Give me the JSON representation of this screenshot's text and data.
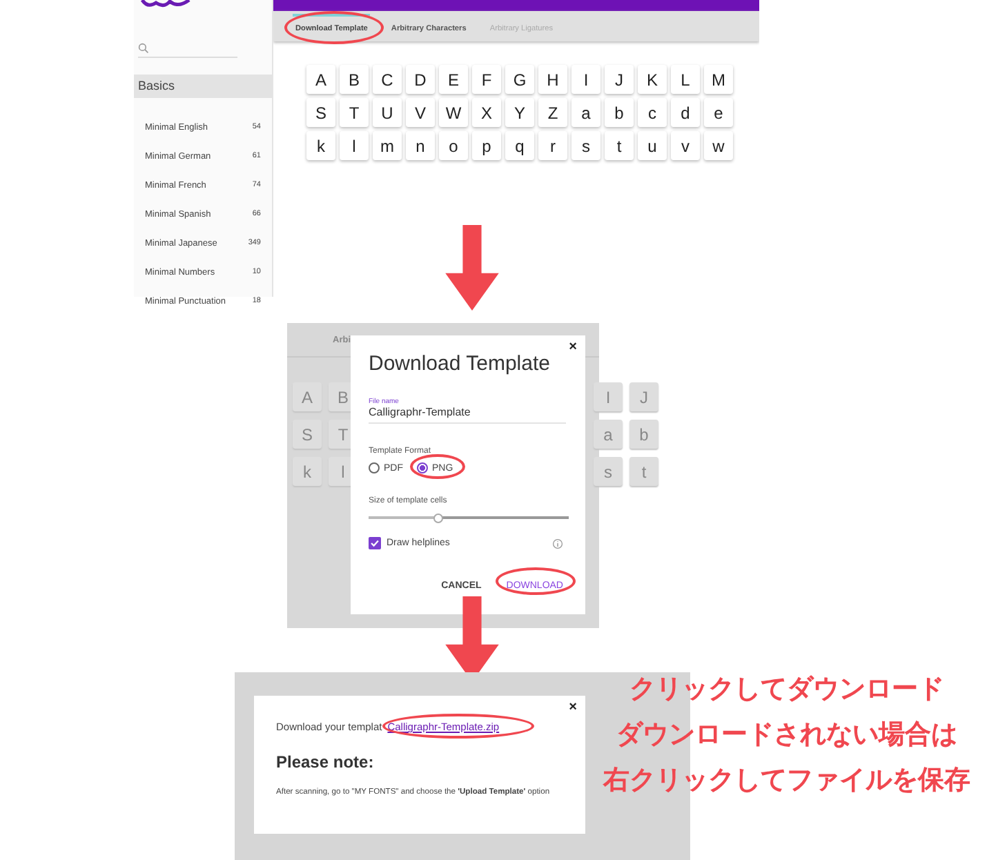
{
  "step1": {
    "sidebar": {
      "section": {
        "label": "Basics",
        "selected": true
      },
      "items": [
        {
          "label": "Minimal English",
          "count": "54"
        },
        {
          "label": "Minimal German",
          "count": "61"
        },
        {
          "label": "Minimal French",
          "count": "74"
        },
        {
          "label": "Minimal Spanish",
          "count": "66"
        },
        {
          "label": "Minimal Japanese",
          "count": "349"
        },
        {
          "label": "Minimal Numbers",
          "count": "10"
        },
        {
          "label": "Minimal Punctuation",
          "count": "18"
        }
      ]
    },
    "tabs": [
      {
        "label": "Download Template",
        "selected": true,
        "disabled": false
      },
      {
        "label": "Arbitrary Characters",
        "selected": false,
        "disabled": false
      },
      {
        "label": "Arbitrary Ligatures",
        "selected": false,
        "disabled": true
      }
    ],
    "characters": [
      [
        "A",
        "B",
        "C",
        "D",
        "E",
        "F",
        "G",
        "H",
        "I",
        "J",
        "K",
        "L",
        "M"
      ],
      [
        "S",
        "T",
        "U",
        "V",
        "W",
        "X",
        "Y",
        "Z",
        "a",
        "b",
        "c",
        "d",
        "e"
      ],
      [
        "k",
        "l",
        "m",
        "n",
        "o",
        "p",
        "q",
        "r",
        "s",
        "t",
        "u",
        "v",
        "w"
      ]
    ]
  },
  "step2": {
    "background_tab": "Arbi",
    "background_characters": [
      [
        "A",
        "B",
        "I",
        "J"
      ],
      [
        "S",
        "T",
        "a",
        "b"
      ],
      [
        "k",
        "l",
        "s",
        "t"
      ]
    ],
    "dialog": {
      "close": "×",
      "title": "Download Template",
      "file_name_label": "File name",
      "file_name_value": "Calligraphr-Template",
      "format_label": "Template Format",
      "formats": [
        {
          "label": "PDF",
          "selected": false
        },
        {
          "label": "PNG",
          "selected": true
        }
      ],
      "size_label": "Size of template cells",
      "size": {
        "level": 0.35
      },
      "helplines": {
        "label": "Draw helplines",
        "checked": true
      },
      "buttons": [
        {
          "label": "CANCEL",
          "kind": "plain"
        },
        {
          "label": "DOWNLOAD",
          "kind": "primary"
        }
      ]
    }
  },
  "step3": {
    "dialog": {
      "close": "×",
      "download_text": "Download your templat",
      "link": "Calligraphr-Template.zip",
      "heading": "Please note:",
      "note": "After scanning, go to \"MY FONTS\" and choose the **'Upload Template'** option"
    }
  },
  "annotation": [
    "クリックしてダウンロード",
    "ダウンロードされない場合は",
    "右クリックしてファイルを保存"
  ]
}
